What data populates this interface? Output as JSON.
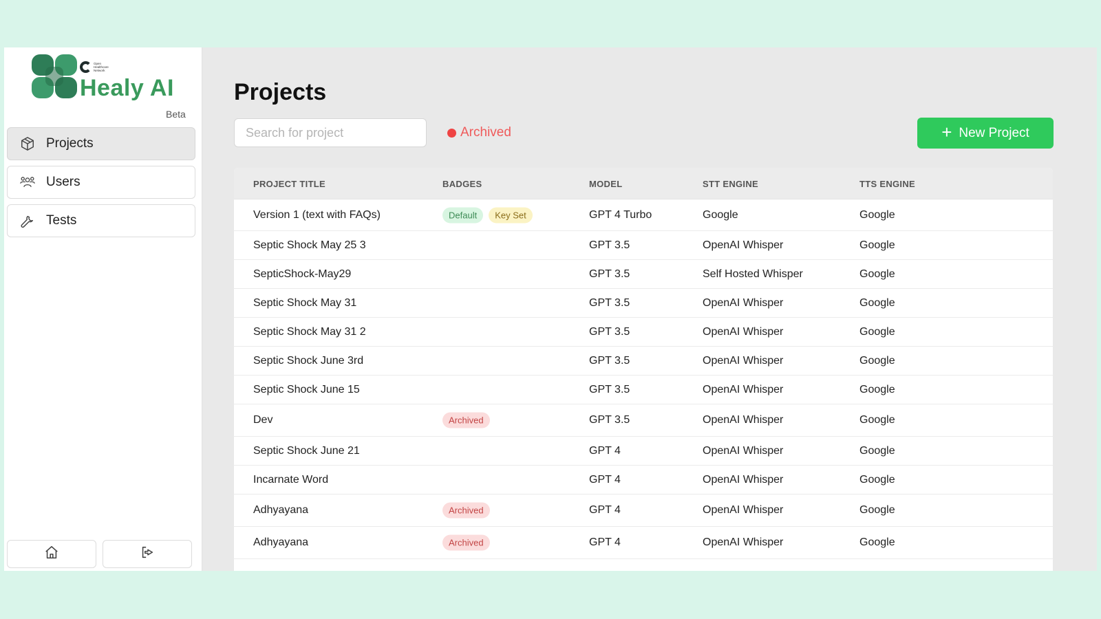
{
  "brand": {
    "name": "Healy AI",
    "tag": "Beta",
    "org_lines": [
      "Open",
      "Healthcare",
      "Network"
    ]
  },
  "sidebar": {
    "items": [
      {
        "label": "Projects",
        "icon": "box-icon",
        "active": true
      },
      {
        "label": "Users",
        "icon": "users-icon",
        "active": false
      },
      {
        "label": "Tests",
        "icon": "wrench-icon",
        "active": false
      }
    ],
    "footer": [
      {
        "icon": "home-icon"
      },
      {
        "icon": "logout-icon"
      }
    ]
  },
  "page": {
    "title": "Projects",
    "search_placeholder": "Search for project",
    "search_value": "",
    "archived_filter_label": "Archived",
    "new_button_label": "New Project"
  },
  "colors": {
    "brand_green": "#3a9a5c",
    "button_green": "#2fca5c",
    "archived_red": "#ef4444",
    "background": "#d9f5ea"
  },
  "table": {
    "columns": [
      "PROJECT TITLE",
      "BADGES",
      "MODEL",
      "STT ENGINE",
      "TTS ENGINE"
    ],
    "rows": [
      {
        "title": "Version 1 (text with FAQs)",
        "badges": [
          {
            "label": "Default",
            "kind": "default"
          },
          {
            "label": "Key Set",
            "kind": "keyset"
          }
        ],
        "model": "GPT 4 Turbo",
        "stt": "Google",
        "tts": "Google"
      },
      {
        "title": "Septic Shock May 25 3",
        "badges": [],
        "model": "GPT 3.5",
        "stt": "OpenAI Whisper",
        "tts": "Google"
      },
      {
        "title": "SepticShock-May29",
        "badges": [],
        "model": "GPT 3.5",
        "stt": "Self Hosted Whisper",
        "tts": "Google"
      },
      {
        "title": "Septic Shock May 31",
        "badges": [],
        "model": "GPT 3.5",
        "stt": "OpenAI Whisper",
        "tts": "Google"
      },
      {
        "title": "Septic Shock May 31 2",
        "badges": [],
        "model": "GPT 3.5",
        "stt": "OpenAI Whisper",
        "tts": "Google"
      },
      {
        "title": "Septic Shock June 3rd",
        "badges": [],
        "model": "GPT 3.5",
        "stt": "OpenAI Whisper",
        "tts": "Google"
      },
      {
        "title": "Septic Shock June 15",
        "badges": [],
        "model": "GPT 3.5",
        "stt": "OpenAI Whisper",
        "tts": "Google"
      },
      {
        "title": "Dev",
        "badges": [
          {
            "label": "Archived",
            "kind": "archived"
          }
        ],
        "model": "GPT 3.5",
        "stt": "OpenAI Whisper",
        "tts": "Google"
      },
      {
        "title": "Septic Shock June 21",
        "badges": [],
        "model": "GPT 4",
        "stt": "OpenAI Whisper",
        "tts": "Google"
      },
      {
        "title": "Incarnate Word",
        "badges": [],
        "model": "GPT 4",
        "stt": "OpenAI Whisper",
        "tts": "Google"
      },
      {
        "title": "Adhyayana",
        "badges": [
          {
            "label": "Archived",
            "kind": "archived"
          }
        ],
        "model": "GPT 4",
        "stt": "OpenAI Whisper",
        "tts": "Google"
      },
      {
        "title": "Adhyayana",
        "badges": [
          {
            "label": "Archived",
            "kind": "archived"
          }
        ],
        "model": "GPT 4",
        "stt": "OpenAI Whisper",
        "tts": "Google"
      }
    ]
  }
}
